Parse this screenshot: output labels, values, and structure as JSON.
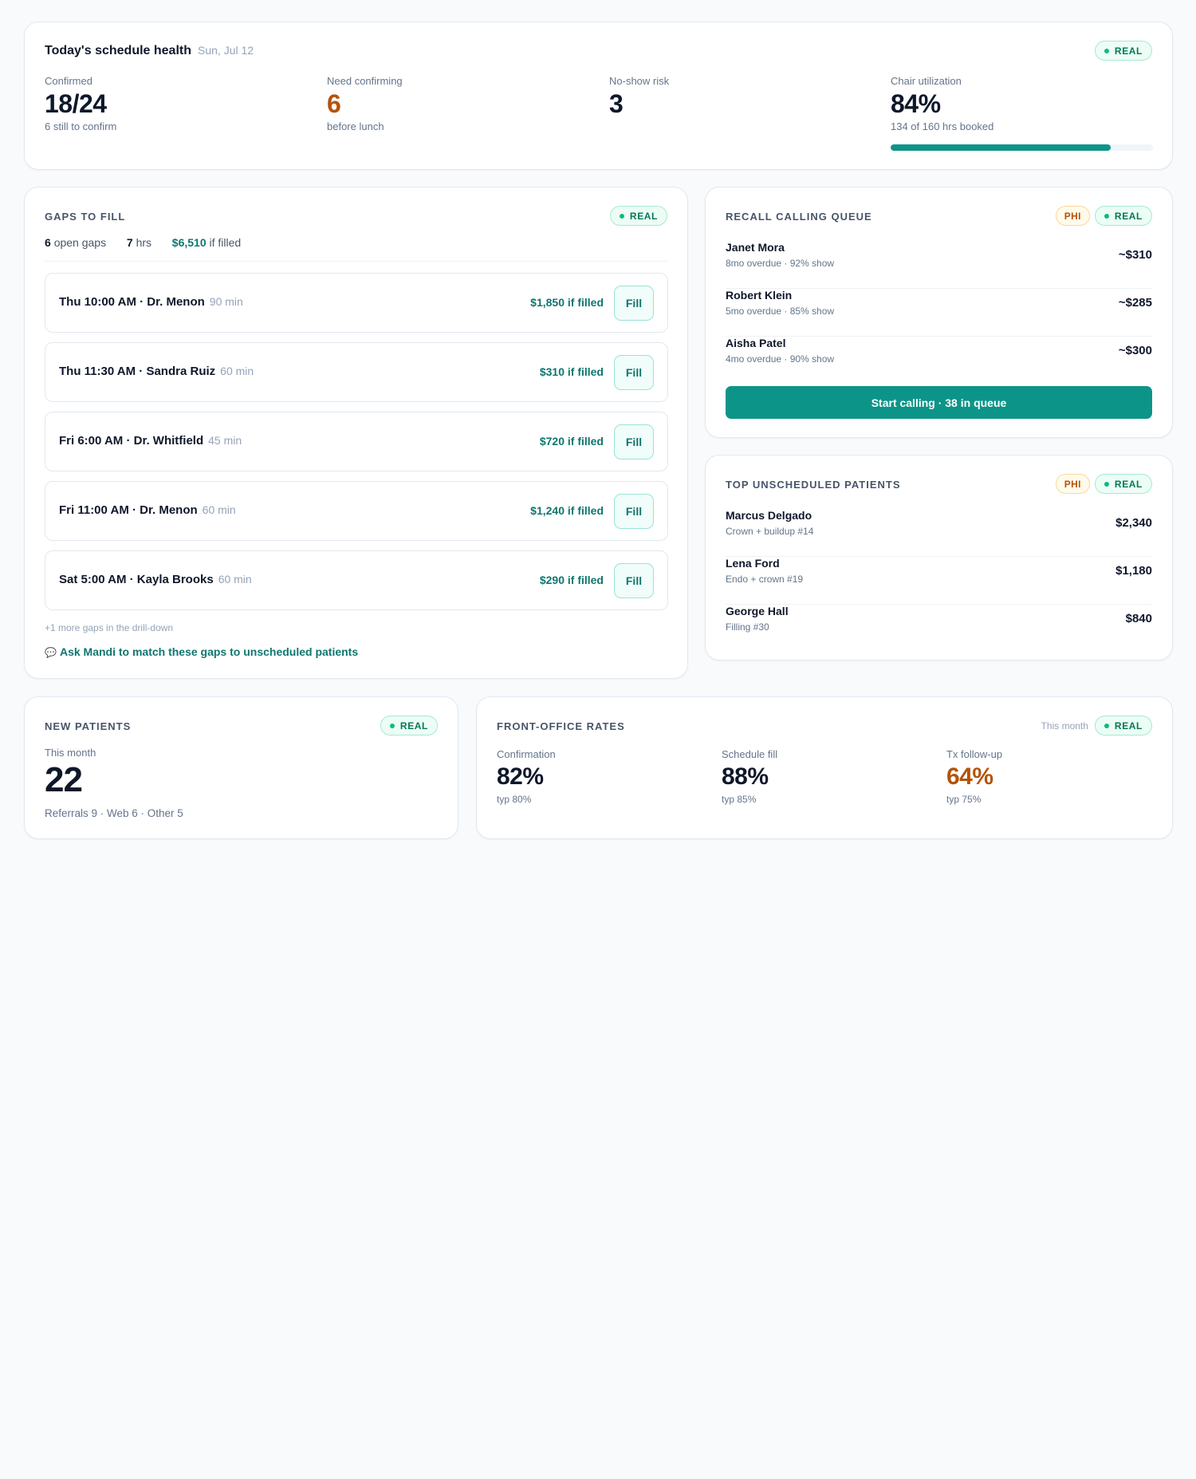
{
  "health": {
    "title": "Today's schedule health",
    "date": "Sun, Jul 12",
    "badge": "REAL",
    "metrics": [
      {
        "label": "Confirmed",
        "value": "18/24",
        "sub": "6 still to confirm"
      },
      {
        "label": "Need confirming",
        "value": "6",
        "sub": "before lunch"
      },
      {
        "label": "No-show risk",
        "value": "3",
        "sub": ""
      },
      {
        "label": "Chair utilization",
        "value": "84%",
        "sub": "134 of 160 hrs booked"
      }
    ],
    "utilization_fraction": 0.84,
    "colors": {
      "accent": "#0d9488",
      "warning": "#b45309"
    }
  },
  "gaps": {
    "title": "GAPS TO FILL",
    "badge": "REAL",
    "summary": {
      "open_count": "6",
      "open_label": "open gaps",
      "hours": "7",
      "hours_label": "hrs",
      "value": "$6,510",
      "value_label": "if filled"
    },
    "rows": [
      {
        "slot": "Thu 10:00 AM · Dr. Menon",
        "duration": "90 min",
        "value": "$1,850 if filled",
        "action": "Fill"
      },
      {
        "slot": "Thu 11:30 AM · Sandra Ruiz",
        "duration": "60 min",
        "value": "$310 if filled",
        "action": "Fill"
      },
      {
        "slot": "Fri 6:00 AM · Dr. Whitfield",
        "duration": "45 min",
        "value": "$720 if filled",
        "action": "Fill"
      },
      {
        "slot": "Fri 11:00 AM · Dr. Menon",
        "duration": "60 min",
        "value": "$1,240 if filled",
        "action": "Fill"
      },
      {
        "slot": "Sat 5:00 AM · Kayla Brooks",
        "duration": "60 min",
        "value": "$290 if filled",
        "action": "Fill"
      }
    ],
    "more_note": "+1 more gaps in the drill-down",
    "ask_icon": "chat-bubble-icon",
    "ask_link": "Ask Mandi to match these gaps to unscheduled patients"
  },
  "recall": {
    "title": "RECALL CALLING QUEUE",
    "phi_badge": "PHI",
    "badge": "REAL",
    "patients": [
      {
        "name": "Janet Mora",
        "meta": "8mo overdue · 92% show",
        "amount": "~$310"
      },
      {
        "name": "Robert Klein",
        "meta": "5mo overdue · 85% show",
        "amount": "~$285"
      },
      {
        "name": "Aisha Patel",
        "meta": "4mo overdue · 90% show",
        "amount": "~$300"
      }
    ],
    "button": "Start calling · 38 in queue"
  },
  "unscheduled": {
    "title": "TOP UNSCHEDULED PATIENTS",
    "phi_badge": "PHI",
    "badge": "REAL",
    "patients": [
      {
        "name": "Marcus Delgado",
        "meta": "Crown + buildup #14",
        "amount": "$2,340"
      },
      {
        "name": "Lena Ford",
        "meta": "Endo + crown #19",
        "amount": "$1,180"
      },
      {
        "name": "George Hall",
        "meta": "Filling #30",
        "amount": "$840"
      }
    ]
  },
  "new_patients": {
    "title": "NEW PATIENTS",
    "badge": "REAL",
    "period": "This month",
    "value": "22",
    "breakdown": "Referrals 9 · Web 6 · Other 5"
  },
  "rates": {
    "title": "FRONT-OFFICE RATES",
    "period": "This month",
    "badge": "REAL",
    "items": [
      {
        "label": "Confirmation",
        "value": "82%",
        "typical": "typ 80%"
      },
      {
        "label": "Schedule fill",
        "value": "88%",
        "typical": "typ 85%"
      },
      {
        "label": "Tx follow-up",
        "value": "64%",
        "typical": "typ 75%"
      }
    ]
  }
}
